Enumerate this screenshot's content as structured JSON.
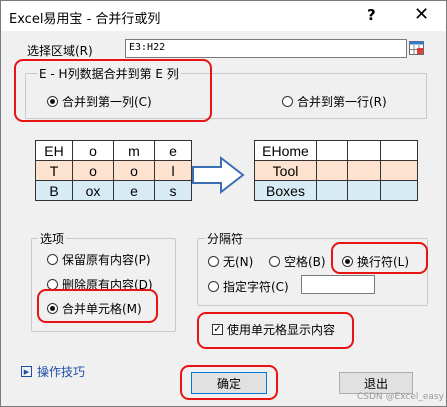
{
  "window": {
    "title": "Excel易用宝 - 合并行或列",
    "help_glyph": "?",
    "close_glyph": "✕"
  },
  "range": {
    "label": "选择区域(R)",
    "value": "E3:H22",
    "picker_icon": "range-picker-icon"
  },
  "merge_target": {
    "legend": "E - H列数据合并到第 E 列",
    "options": [
      {
        "label": "合并到第一列(C)",
        "checked": true
      },
      {
        "label": "合并到第一行(R)",
        "checked": false
      }
    ]
  },
  "preview": {
    "before_rows": [
      [
        "EH",
        "o",
        "m",
        "e"
      ],
      [
        "T",
        "o",
        "o",
        "l"
      ],
      [
        "B",
        "ox",
        "e",
        "s"
      ]
    ],
    "after_rows": [
      [
        "EHome",
        "",
        "",
        ""
      ],
      [
        "Tool",
        "",
        "",
        ""
      ],
      [
        "Boxes",
        "",
        "",
        ""
      ]
    ],
    "arrow_icon": "right-arrow-icon",
    "row_colors": [
      "#ffffff",
      "#fde2cf",
      "#d7ebf5"
    ]
  },
  "options_group": {
    "legend": "选项",
    "items": [
      {
        "label": "保留原有内容(P)",
        "checked": false
      },
      {
        "label": "删除原有内容(D)",
        "checked": false
      },
      {
        "label": "合并单元格(M)",
        "checked": true
      }
    ]
  },
  "separator_group": {
    "legend": "分隔符",
    "items": [
      {
        "label": "无(N)",
        "checked": false
      },
      {
        "label": "空格(B)",
        "checked": false
      },
      {
        "label": "换行符(L)",
        "checked": true
      },
      {
        "label": "指定字符(C)",
        "checked": false
      }
    ],
    "custom_value": ""
  },
  "use_cell_display": {
    "label": "使用单元格显示内容",
    "checked": true,
    "mark": "✓"
  },
  "tips_link": {
    "label": "操作技巧",
    "icon": "play-tri-icon"
  },
  "buttons": {
    "ok": "确定",
    "exit": "退出"
  },
  "watermark": "CSDN @Excel_easy",
  "colors": {
    "highlight": "#e81414",
    "link": "#1e4fa8",
    "arrow": "#3b6fb3"
  }
}
